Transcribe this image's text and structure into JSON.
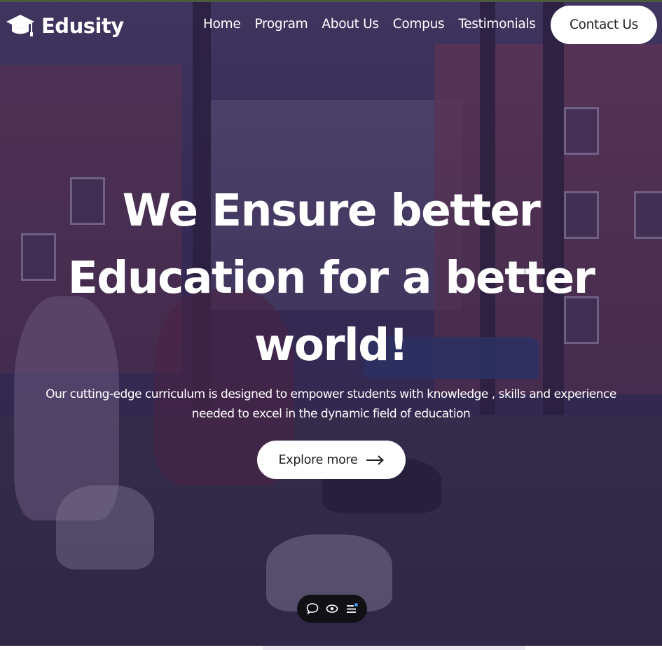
{
  "nav": {
    "logo_text": "Edusity",
    "links": [
      "Home",
      "Program",
      "About Us",
      "Compus",
      "Testimonials"
    ],
    "contact_label": "Contact Us"
  },
  "hero": {
    "title_line1": "We Ensure better",
    "title_line2": "Education for a better",
    "title_line3": "world!",
    "subtitle_line1": "Our cutting-edge curriculum is designed to empower students with knowledge , skills and experience",
    "subtitle_line2": "needed to excel in the dynamic field of education",
    "button_label": "Explore more"
  },
  "icons": {
    "logo": "graduation-cap-icon",
    "button_arrow": "arrow-right-icon",
    "toolbar": [
      "chat-bubble-icon",
      "eye-icon",
      "menu-list-icon"
    ]
  },
  "colors": {
    "overlay": "#281850",
    "button_bg": "#ffffff",
    "toolbar_bg": "#111015",
    "notification_dot": "#3aa0ff"
  }
}
